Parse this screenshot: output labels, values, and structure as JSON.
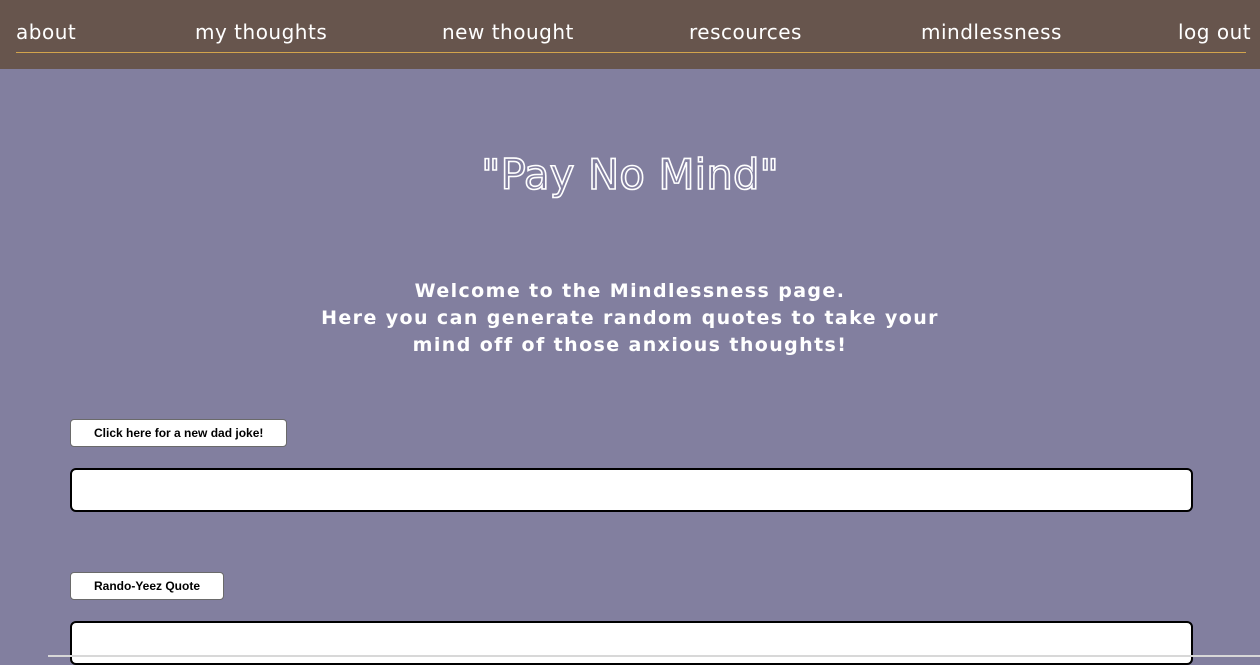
{
  "nav": {
    "about": "about",
    "my_thoughts": "my thoughts",
    "new_thought": "new thought",
    "resources": "rescources",
    "mindlessness": "mindlessness",
    "log_out": "log out"
  },
  "main": {
    "title": "\"Pay No Mind\"",
    "welcome_lines": [
      "Welcome to the Mindlessness page.",
      "Here you can generate random quotes to take your",
      "mind off of those anxious thoughts!"
    ],
    "dad_joke_button": "Click here for a new dad joke!",
    "dad_joke_output": "",
    "yeezy_button": "Rando-Yeez Quote",
    "yeezy_output": ""
  },
  "colors": {
    "background": "#827f9f",
    "navbar": "#67554d",
    "nav_rule": "#d3a44c"
  }
}
